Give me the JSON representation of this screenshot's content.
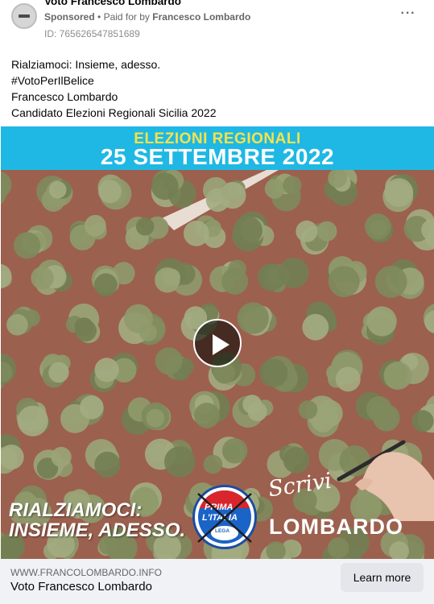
{
  "header": {
    "page_name": "Voto Francesco Lombardo",
    "sponsored": "Sponsored",
    "paid_for_prefix": "Paid for by",
    "paid_for_name": "Francesco Lombardo",
    "ad_id": "ID: 765626547851689",
    "more_icon": "more-horizontal-icon",
    "more_label": "···"
  },
  "caption": {
    "lines": [
      "Rialziamoci: Insieme, adesso.",
      "#VotoPerIlBelice",
      "Francesco Lombardo",
      "Candidato Elezioni Regionali Sicilia 2022"
    ]
  },
  "media": {
    "banner_top": "ELEZIONI REGIONALI",
    "banner_bottom": "25 SETTEMBRE 2022",
    "slogan_line1": "RIALZIAMOCI:",
    "slogan_line2": "INSIEME, ADESSO.",
    "logo_line1": "PRIMA",
    "logo_line2": "L'ITALIA",
    "logo_bottom": "LEGA",
    "scrivi": "Scrivi",
    "candidate": "LOMBARDO",
    "play_icon": "play-icon",
    "colors": {
      "banner": "#1fb8e4",
      "banner_top_text": "#f7e24a",
      "soil": "#9a5f4e",
      "trees": "#8f9a6b"
    }
  },
  "footer": {
    "domain": "WWW.FRANCOLOMBARDO.INFO",
    "title": "Voto Francesco Lombardo",
    "cta_label": "Learn more"
  }
}
